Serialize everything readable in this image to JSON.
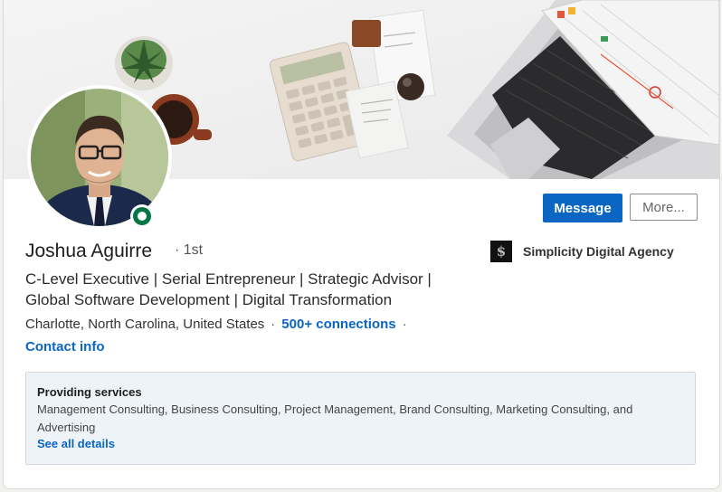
{
  "profile": {
    "name": "Joshua Aguirre",
    "degree": "· 1st",
    "headline": "C-Level Executive | Serial Entrepreneur | Strategic Advisor | Global Software Development | Digital Transformation",
    "location": "Charlotte, North Carolina, United States",
    "separator": "·",
    "connections": "500+ connections",
    "contact_info": "Contact info",
    "company": {
      "logo_glyph": "$",
      "name": "Simplicity Digital Agency"
    },
    "online_status_color": "#057642"
  },
  "actions": {
    "message_label": "Message",
    "more_label": "More..."
  },
  "services": {
    "title": "Providing services",
    "list": "Management Consulting, Business Consulting, Project Management, Brand Consulting, Marketing Consulting, and Advertising",
    "link": "See all details"
  },
  "colors": {
    "accent": "#0a66c2",
    "services_bg": "#eef3f8"
  }
}
